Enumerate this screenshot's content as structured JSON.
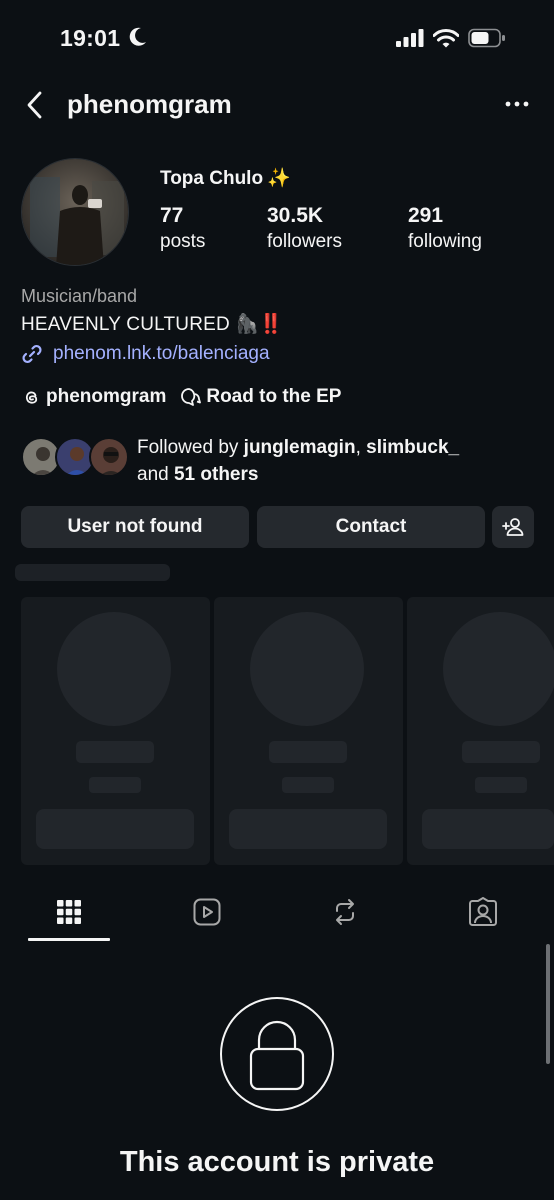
{
  "status_bar": {
    "time": "19:01",
    "icons": [
      "moon-icon",
      "cellular-signal-icon",
      "wifi-icon",
      "battery-icon"
    ]
  },
  "header": {
    "title": "phenomgram",
    "back_icon": "chevron-left-icon",
    "more_icon": "more-horizontal-icon"
  },
  "profile": {
    "display_name": "Topa Chulo",
    "display_emoji": "✨",
    "stats": [
      {
        "value": "77",
        "label": "posts"
      },
      {
        "value": "30.5K",
        "label": "followers"
      },
      {
        "value": "291",
        "label": "following"
      }
    ],
    "category": "Musician/band",
    "bio": "HEAVENLY CULTURED 🦍‼️",
    "link": "phenom.lnk.to/balenciaga",
    "threads_handle": "phenomgram",
    "channel_name": "Road to the EP"
  },
  "followed_by": {
    "prefix": "Followed by ",
    "name1": "junglemagin",
    "separator": ", ",
    "name2": "slimbuck_",
    "and_text": "and ",
    "others": "51 others"
  },
  "buttons": {
    "primary": "User not found",
    "contact": "Contact",
    "add_icon": "add-person-icon"
  },
  "tabs": [
    {
      "icon": "grid-icon",
      "active": true
    },
    {
      "icon": "reels-icon",
      "active": false
    },
    {
      "icon": "reposts-icon",
      "active": false
    },
    {
      "icon": "tagged-icon",
      "active": false
    }
  ],
  "private": {
    "icon": "lock-icon",
    "message": "This account is private"
  },
  "colors": {
    "background": "#0c1014",
    "button": "#25292e",
    "link": "#a4b1ff",
    "muted": "#a8a8a8"
  }
}
